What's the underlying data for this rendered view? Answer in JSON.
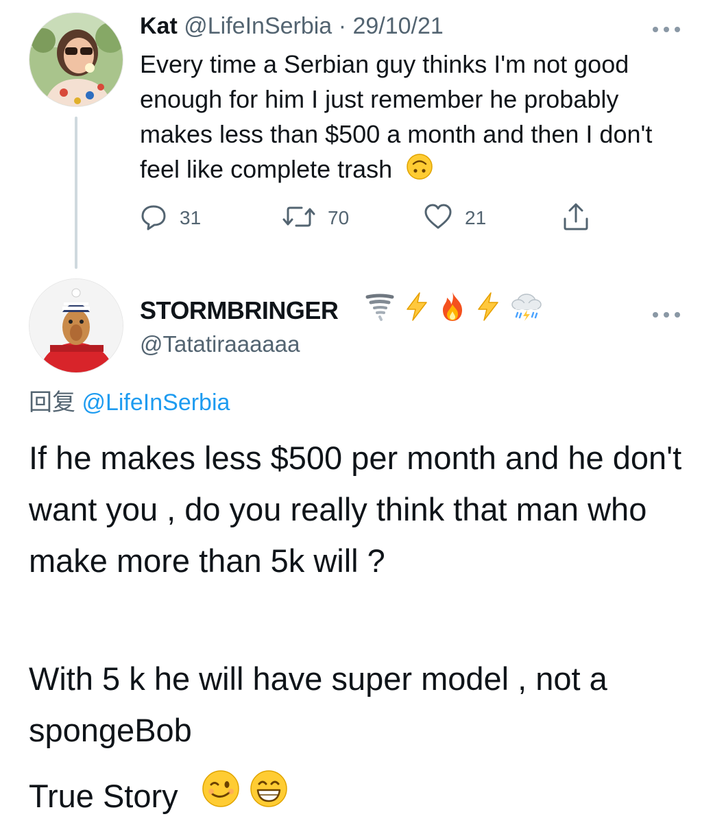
{
  "tweet1": {
    "display_name": "Kat",
    "handle": "@LifeInSerbia",
    "separator": "·",
    "date": "29/10/21",
    "text": "Every time a Serbian guy thinks I'm not good enough for him I just remember he probably makes less than $500 a month and then I don't feel like complete trash",
    "text_emoji": "upside-down-face",
    "actions": {
      "reply_count": "31",
      "retweet_count": "70",
      "like_count": "21"
    }
  },
  "tweet2": {
    "display_name": "STORMBRINGER",
    "name_emojis": [
      "tornado",
      "high-voltage",
      "fire",
      "high-voltage",
      "cloud-with-lightning-and-rain"
    ],
    "handle": "@Tatatiraaaaaa",
    "reply_prefix": "回复",
    "reply_to": "@LifeInSerbia",
    "paragraph1": "If he makes less $500 per month and he don't want you , do you really think that man who make more than 5k will ?",
    "paragraph2": "With 5 k he will have super model , not a spongeBob",
    "paragraph3": "True Story",
    "paragraph3_emojis": [
      "winking-face",
      "grinning-face"
    ]
  },
  "colors": {
    "text": "#0f1419",
    "secondary": "#536471",
    "link": "#1d9bf0",
    "thread_line": "#cfd9de"
  }
}
